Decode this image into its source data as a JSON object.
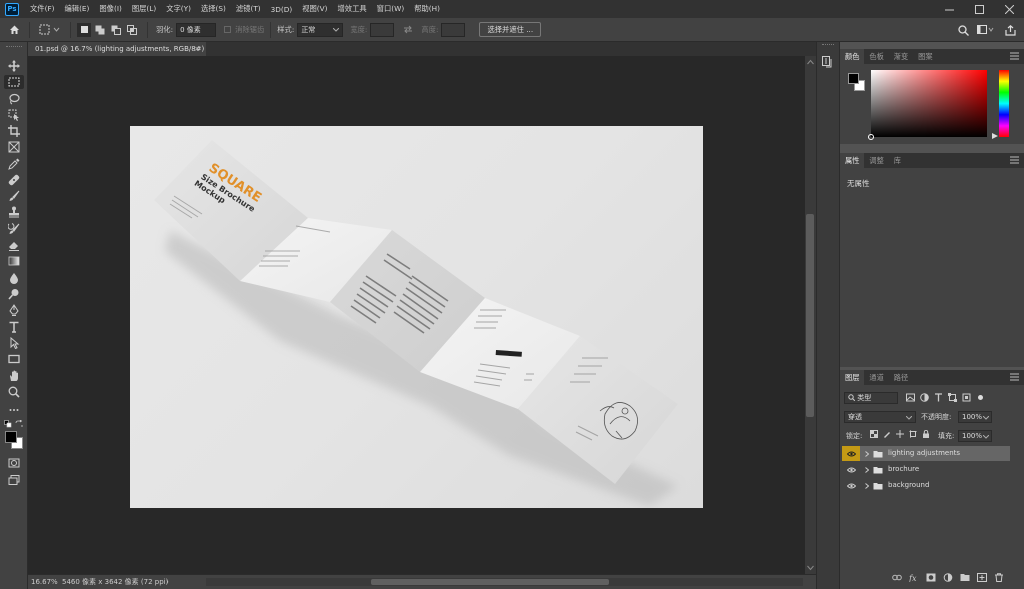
{
  "app": {
    "logo": "Ps"
  },
  "menu": [
    "文件(F)",
    "编辑(E)",
    "图像(I)",
    "图层(L)",
    "文字(Y)",
    "选择(S)",
    "滤镜(T)",
    "3D(D)",
    "视图(V)",
    "增效工具",
    "窗口(W)",
    "帮助(H)"
  ],
  "options": {
    "feather_label": "羽化:",
    "feather_value": "0 像素",
    "antialias_label": "消除锯齿",
    "style_label": "样式:",
    "style_value": "正常",
    "width_label": "宽度:",
    "height_label": "高度:",
    "select_mask_button": "选择并遮住 ..."
  },
  "document": {
    "tab_title": "01.psd @ 16.7% (lighting adjustments, RGB/8#)",
    "close_glyph": "×"
  },
  "status": {
    "zoom": "16.67%",
    "info": "5460 像素 x 3642 像素 (72 ppi)",
    "arrow": "›"
  },
  "mockup": {
    "title": "SQUARE",
    "subtitle1": "Size Brochure",
    "subtitle2": "Mockup"
  },
  "color_panel": {
    "tabs": [
      "颜色",
      "色板",
      "渐变",
      "图案"
    ],
    "foreground": "#000000",
    "background": "#ffffff",
    "hue": "#ff0000"
  },
  "properties_panel": {
    "tabs": [
      "属性",
      "调整",
      "库"
    ],
    "content": "无属性"
  },
  "layers_panel": {
    "tabs": [
      "图层",
      "通道",
      "路径"
    ],
    "filter_label": "类型",
    "blend_mode": "穿透",
    "opacity_label": "不透明度:",
    "opacity_value": "100%",
    "lock_label": "锁定:",
    "fill_label": "填充:",
    "fill_value": "100%",
    "layers": [
      {
        "name": "lighting adjustments",
        "selected": true
      },
      {
        "name": "brochure",
        "selected": false
      },
      {
        "name": "background",
        "selected": false
      }
    ]
  },
  "colors": {
    "accent_orange": "#e1902a",
    "eye_highlight": "#c49a15"
  }
}
